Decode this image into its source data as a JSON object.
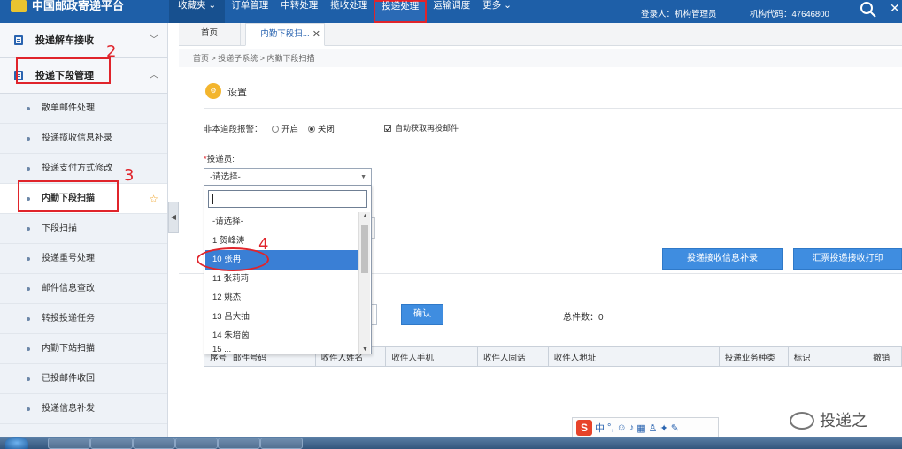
{
  "topbar": {
    "logo_text": "中国邮政寄递平台",
    "nav": [
      "收藏夹",
      "订单管理",
      "中转处理",
      "揽收处理",
      "投递处理",
      "运输调度",
      "更多"
    ],
    "active_nav_index": 4,
    "login_text": "登录人：机构管理员",
    "org_code_text": "机构代码：47646800"
  },
  "sidebar": {
    "groups": [
      {
        "label": "投递解车接收",
        "expanded": false
      },
      {
        "label": "投递下段管理",
        "expanded": true
      }
    ],
    "items": [
      "散单邮件处理",
      "投递揽收信息补录",
      "投递支付方式修改",
      "内勤下段扫描",
      "下段扫描",
      "投递重号处理",
      "邮件信息查改",
      "转投投递任务",
      "内勤下站扫描",
      "已投邮件收回",
      "投递信息补发"
    ],
    "active_item_index": 3
  },
  "annotations": [
    "2",
    "3",
    "4"
  ],
  "tabs": {
    "home": "首页",
    "current": "内勤下段扫..."
  },
  "breadcrumb": "首页  >  投递子系统  >  内勤下段扫描",
  "settings": {
    "title": "设置",
    "alarm_label": "非本道段报警：",
    "alarm_on": "开启",
    "alarm_off": "关闭",
    "alarm_value": "关闭",
    "auto_fetch_label": "自动获取再投邮件",
    "auto_fetch_checked": true
  },
  "courier": {
    "required_mark": "*",
    "label": "投递员:",
    "placeholder": "-请选择-",
    "options": [
      "-请选择-",
      "1 贺峰涛",
      "10 张冉",
      "11 张莉莉",
      "12 姚杰",
      "13 吕大抽",
      "14 朱培茵",
      "15 ..."
    ],
    "highlighted_index": 2
  },
  "buttons": {
    "record": "投递接收信息补录",
    "print": "汇票投递接收打印",
    "confirm": "确认"
  },
  "total_count": "总件数：0",
  "table": {
    "headers": [
      "序号",
      "邮件号码",
      "收件人姓名",
      "收件人手机",
      "收件人固话",
      "收件人地址",
      "投递业务种类",
      "标识",
      "撤销"
    ]
  },
  "ime": {
    "labels": [
      "中",
      "°,"
    ]
  },
  "watermark": "投递之",
  "colors": {
    "header_blue": "#1e5fa8",
    "button_blue": "#3f8de0",
    "highlight_blue": "#3a7fd5",
    "annotation_red": "#e0242b"
  }
}
